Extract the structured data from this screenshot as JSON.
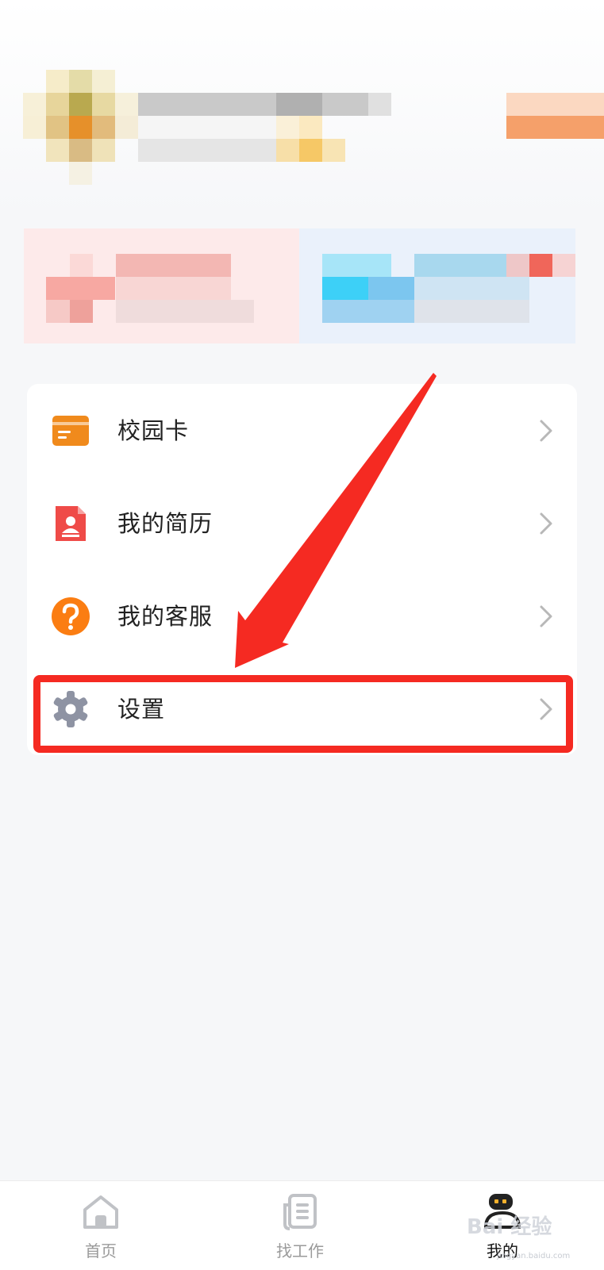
{
  "menu": {
    "items": [
      {
        "label": "校园卡",
        "icon": "campus-card-icon",
        "color": "#f08a1c"
      },
      {
        "label": "我的简历",
        "icon": "resume-icon",
        "color": "#ef4b48"
      },
      {
        "label": "我的客服",
        "icon": "customer-service-icon",
        "color": "#fb7d12"
      },
      {
        "label": "设置",
        "icon": "gear-icon",
        "color": "#8e93a3"
      }
    ]
  },
  "bottom_nav": {
    "items": [
      {
        "label": "首页",
        "icon": "home-icon",
        "active": false
      },
      {
        "label": "找工作",
        "icon": "job-list-icon",
        "active": false
      },
      {
        "label": "我的",
        "icon": "profile-icon",
        "active": true
      }
    ]
  },
  "annotation": {
    "highlight_color": "#f52a22",
    "target": "设置"
  },
  "watermark": {
    "text": "Bai 经验",
    "sub": "jingyan.baidu.com"
  }
}
